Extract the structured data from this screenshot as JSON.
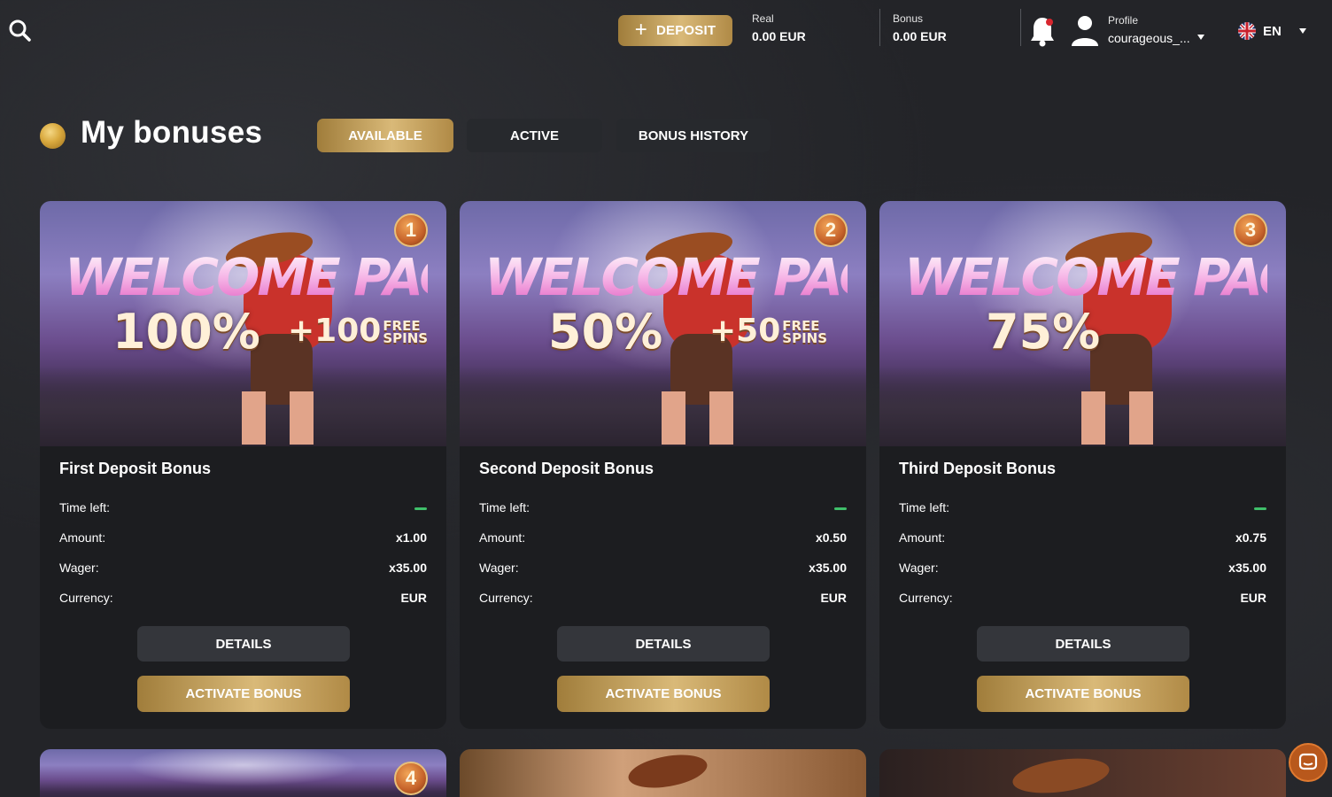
{
  "header": {
    "deposit_label": "DEPOSIT",
    "real": {
      "label": "Real",
      "value": "0.00 EUR"
    },
    "bonus": {
      "label": "Bonus",
      "value": "0.00 EUR"
    },
    "profile": {
      "label": "Profile",
      "username": "courageous_..."
    },
    "language": "EN"
  },
  "page": {
    "title": "My bonuses",
    "tabs": [
      {
        "label": "AVAILABLE",
        "active": true
      },
      {
        "label": "ACTIVE",
        "active": false
      },
      {
        "label": "BONUS HISTORY",
        "active": false
      }
    ]
  },
  "labels": {
    "time_left": "Time left:",
    "amount": "Amount:",
    "wager": "Wager:",
    "currency": "Currency:",
    "details": "DETAILS",
    "activate": "ACTIVATE BONUS"
  },
  "cards": [
    {
      "title": "First Deposit Bonus",
      "banner_title": "WELCOME PACK",
      "banner_percent": "100%",
      "banner_spins": "+100",
      "banner_free": "FREE",
      "banner_spins_word": "SPINS",
      "medal": "1",
      "time_left": "—",
      "amount": "x1.00",
      "wager": "x35.00",
      "currency": "EUR"
    },
    {
      "title": "Second Deposit Bonus",
      "banner_title": "WELCOME PACK",
      "banner_percent": "50%",
      "banner_spins": "+50",
      "banner_free": "FREE",
      "banner_spins_word": "SPINS",
      "medal": "2",
      "time_left": "—",
      "amount": "x0.50",
      "wager": "x35.00",
      "currency": "EUR"
    },
    {
      "title": "Third Deposit Bonus",
      "banner_title": "WELCOME PACK",
      "banner_percent": "75%",
      "medal": "3",
      "time_left": "—",
      "amount": "x0.75",
      "wager": "x35.00",
      "currency": "EUR"
    }
  ],
  "partial_cards": [
    {
      "medal": "4"
    }
  ],
  "colors": {
    "background": "#232428",
    "card": "#1c1d20",
    "gold": "#d9b978",
    "details_button": "#34363b",
    "time_indicator": "#3fbf6a",
    "chat": "#b8581c"
  }
}
